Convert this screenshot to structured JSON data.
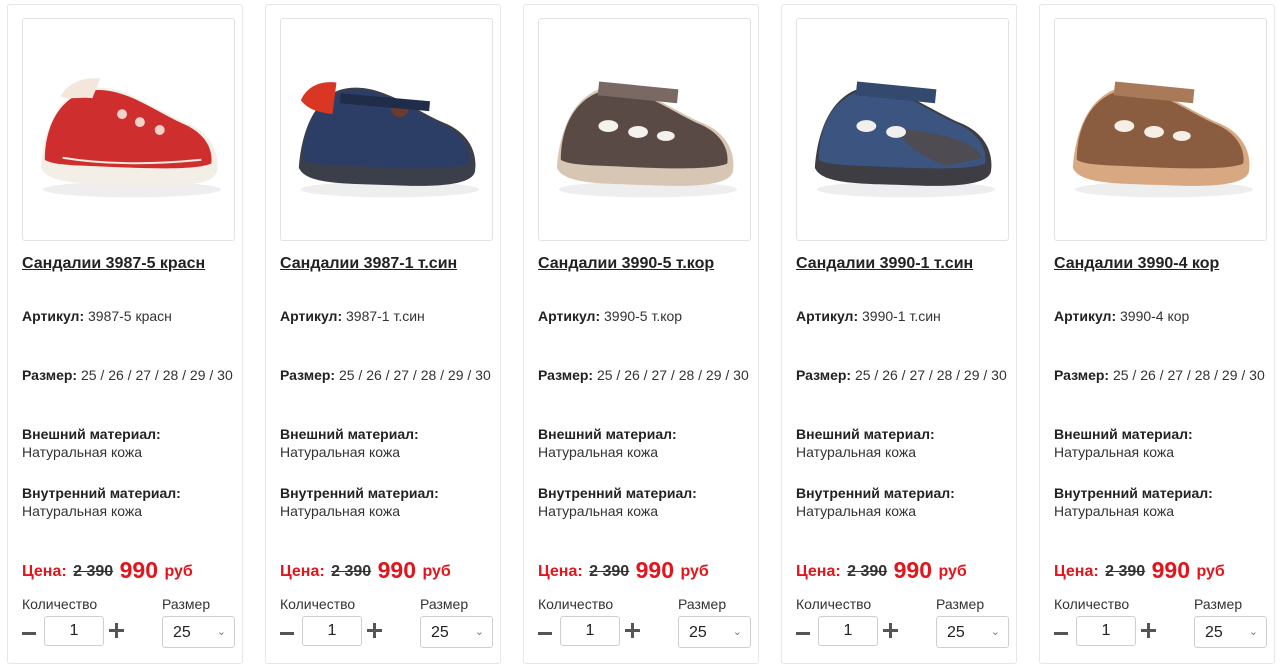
{
  "labels": {
    "article": "Артикул:",
    "size": "Размер:",
    "outer_material": "Внешний материал:",
    "inner_material": "Внутренний материал:",
    "price": "Цена:",
    "quantity": "Количество",
    "size_select": "Размер",
    "currency": "руб"
  },
  "products": [
    {
      "title": "Сандалии 3987-5 красн",
      "article": "3987-5 красн",
      "sizes": "25 / 26 / 27 / 28 / 29 / 30",
      "outer": "Натуральная кожа",
      "inner": "Натуральная кожа",
      "old_price": "2 390",
      "new_price": "990",
      "quantity": "1",
      "selected_size": "25",
      "colors": {
        "upper": "#cf2e2e",
        "accent": "#f3e7dc",
        "sole": "#f3eee6"
      }
    },
    {
      "title": "Сандалии 3987-1 т.син",
      "article": "3987-1 т.син",
      "sizes": "25 / 26 / 27 / 28 / 29 / 30",
      "outer": "Натуральная кожа",
      "inner": "Натуральная кожа",
      "old_price": "2 390",
      "new_price": "990",
      "quantity": "1",
      "selected_size": "25",
      "colors": {
        "upper": "#2c3e66",
        "accent": "#d93624",
        "sole": "#3a3f4a"
      }
    },
    {
      "title": "Сандалии 3990-5 т.кор",
      "article": "3990-5 т.кор",
      "sizes": "25 / 26 / 27 / 28 / 29 / 30",
      "outer": "Натуральная кожа",
      "inner": "Натуральная кожа",
      "old_price": "2 390",
      "new_price": "990",
      "quantity": "1",
      "selected_size": "25",
      "colors": {
        "upper": "#5a4a45",
        "accent": "#7a6862",
        "sole": "#d8c6b4"
      }
    },
    {
      "title": "Сандалии 3990-1 т.син",
      "article": "3990-1 т.син",
      "sizes": "25 / 26 / 27 / 28 / 29 / 30",
      "outer": "Натуральная кожа",
      "inner": "Натуральная кожа",
      "old_price": "2 390",
      "new_price": "990",
      "quantity": "1",
      "selected_size": "25",
      "colors": {
        "upper": "#3b5580",
        "accent": "#4e4b52",
        "sole": "#3e3d44"
      }
    },
    {
      "title": "Сандалии 3990-4 кор",
      "article": "3990-4 кор",
      "sizes": "25 / 26 / 27 / 28 / 29 / 30",
      "outer": "Натуральная кожа",
      "inner": "Натуральная кожа",
      "old_price": "2 390",
      "new_price": "990",
      "quantity": "1",
      "selected_size": "25",
      "colors": {
        "upper": "#8a5d40",
        "accent": "#a87a5a",
        "sole": "#d8a882"
      }
    }
  ],
  "theme": {
    "price_color": "#e3141b"
  }
}
